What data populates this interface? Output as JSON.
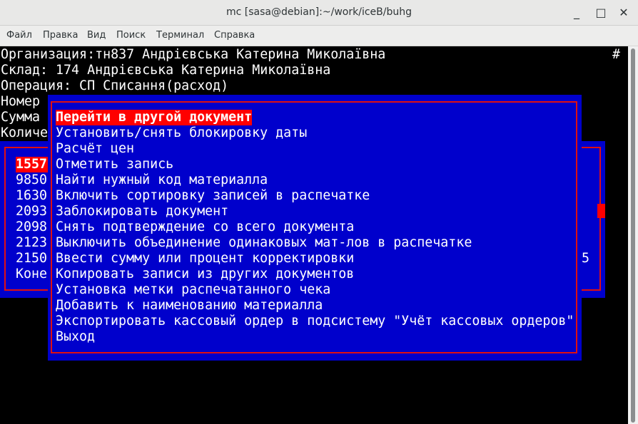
{
  "window": {
    "title": "mc [sasa@debian]:~/work/iceB/buhg",
    "minimize": "_",
    "maximize": "□",
    "close": "✕"
  },
  "menubar": [
    "Файл",
    "Правка",
    "Вид",
    "Поиск",
    "Терминал",
    "Справка"
  ],
  "header": {
    "org": "Организация:тн837 Андрієвська Катерина Миколаївна",
    "hash": "#",
    "sklad": "Склад: 174 Андрієвська Катерина Миколаївна",
    "operation": "Операция: СП Списання(расход)",
    "nomer": "Номер",
    "summa": "Сумма",
    "kolich": "Количе"
  },
  "rows": [
    "1557",
    "9850",
    "1630",
    "2093",
    "2098",
    "2123",
    "2150",
    "Коне"
  ],
  "row_right_digit": "5",
  "menu": {
    "selected": "Перейти в другой документ",
    "items": [
      "Установить/снять блокировку даты",
      "Расчёт цен",
      "Отметить запись",
      "Найти нужный код материалла",
      "Включить сортировку записей в распечатке",
      "Заблокировать документ",
      "Снять подтверждение со всего документа",
      "Выключить объединение одинаковых мат-лов в распечатке",
      "Ввести сумму или процент корректировки",
      "Копировать записи из других документов",
      "Установка метки распечатанного чека",
      "Добавить к наименованию материалла",
      "Экспортировать кассовый ордер в подсистему \"Учёт кассовых ордеров\"",
      "Выход"
    ]
  }
}
